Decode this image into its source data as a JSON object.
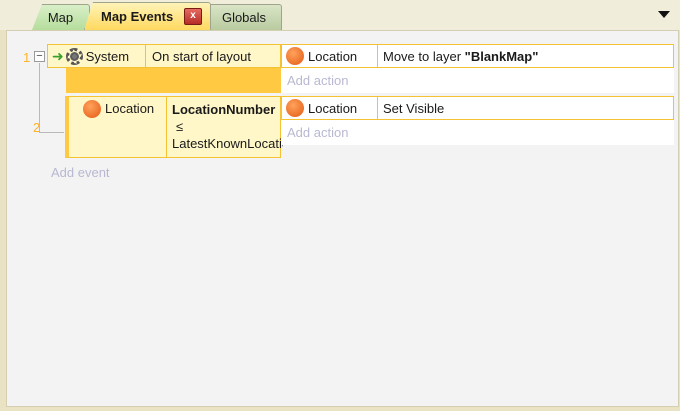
{
  "tabs": [
    {
      "label": "Map"
    },
    {
      "label": "Map Events"
    },
    {
      "label": "Globals"
    }
  ],
  "tab_close_label": "x",
  "events": [
    {
      "number": "1",
      "condition": {
        "object": "System",
        "text": "On start of layout"
      },
      "action": {
        "object": "Location",
        "text_prefix": "Move to layer ",
        "text_value": "\"BlankMap\""
      },
      "add_action": "Add action"
    },
    {
      "number": "2",
      "condition": {
        "object": "Location",
        "text_bold": "LocationNumber",
        "text_op": "≤",
        "text_rest": "LatestKnownLocation"
      },
      "action": {
        "object": "Location",
        "text": "Set Visible"
      },
      "add_action": "Add action"
    }
  ],
  "add_event": "Add event",
  "icons": {
    "system": "gear-icon",
    "trigger": "green-arrow-icon",
    "object": "orange-circle-icon"
  },
  "colors": {
    "event_number": "#ffb32c",
    "condition_bg": "#fff7c7",
    "border": "#f5c234",
    "add_link": "#b8b8d2"
  }
}
